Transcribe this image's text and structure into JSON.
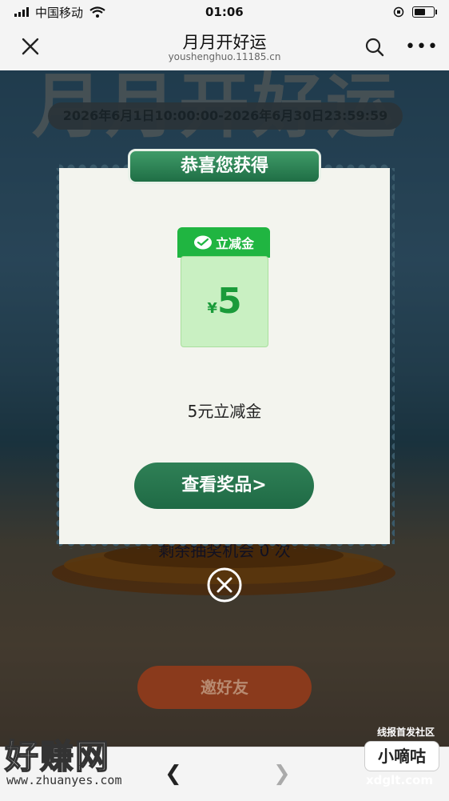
{
  "status": {
    "carrier": "中国移动",
    "time": "01:06"
  },
  "nav": {
    "title": "月月开好运",
    "subtitle": "youshenghuo.11185.cn"
  },
  "page": {
    "big_title": "月月开好运",
    "date_range": "2026年6月1日10:00:00-2026年6月30日23:59:59",
    "remaining_text": "剩余抽奖机会 0 次",
    "invite_label": "邀好友",
    "community_mark": "线报首发社区"
  },
  "modal": {
    "header": "恭喜您获得",
    "coupon_tag": "立减金",
    "currency": "¥",
    "amount": "5",
    "prize_name": "5元立减金",
    "view_button": "查看奖品>"
  },
  "watermarks": {
    "left_logo": "好赚网",
    "left_url": "www.zhuanyes.com",
    "right_badge": "小嘀咕",
    "right_url": "xdglt.com"
  },
  "colors": {
    "accent_green": "#1f6e45",
    "coupon_green": "#20b541"
  }
}
